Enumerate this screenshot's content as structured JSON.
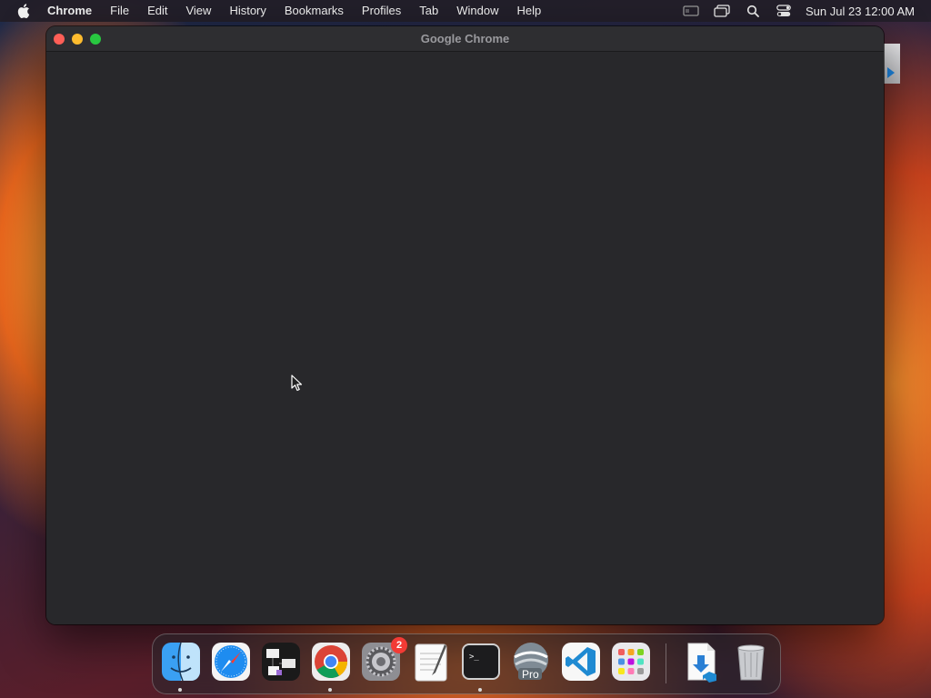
{
  "menubar": {
    "app_name": "Chrome",
    "items": [
      "File",
      "Edit",
      "View",
      "History",
      "Bookmarks",
      "Profiles",
      "Tab",
      "Window",
      "Help"
    ],
    "status_icons": [
      "screen-mirroring-icon",
      "window-switch-icon",
      "spotlight-search-icon",
      "control-center-icon"
    ],
    "clock": "Sun Jul 23  12:00 AM"
  },
  "window": {
    "title": "Google Chrome"
  },
  "dock": {
    "apps": [
      {
        "name": "finder",
        "running": true
      },
      {
        "name": "safari",
        "running": false
      },
      {
        "name": "flowchart-app",
        "running": false
      },
      {
        "name": "google-chrome",
        "running": true
      },
      {
        "name": "system-settings",
        "running": false,
        "badge": "2"
      },
      {
        "name": "textedit",
        "running": false
      },
      {
        "name": "terminal",
        "running": true
      },
      {
        "name": "google-earth-pro",
        "running": false,
        "label": "Pro"
      },
      {
        "name": "visual-studio-code",
        "running": false
      },
      {
        "name": "launchpad",
        "running": false
      },
      {
        "name": "downloads-folder",
        "running": false
      },
      {
        "name": "trash",
        "running": false
      }
    ]
  }
}
